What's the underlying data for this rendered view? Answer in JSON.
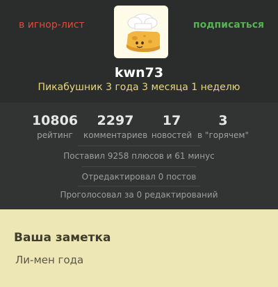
{
  "header": {
    "ignore_label": "в игнор-лист",
    "subscribe_label": "подписаться"
  },
  "profile": {
    "username": "kwn73",
    "tenure": "Пикабушник 3 года 3 месяца 1 неделю"
  },
  "stats": [
    {
      "value": "10806",
      "label": "рейтинг"
    },
    {
      "value": "2297",
      "label": "комментариев"
    },
    {
      "value": "17",
      "label": "новостей"
    },
    {
      "value": "3",
      "label": "в \"горячем\""
    }
  ],
  "activity": {
    "votes": "Поставил 9258 плюсов и 61 минус",
    "edited": "Отредактировал 0 постов",
    "voted_edits": "Проголосовал за 0 редактирований"
  },
  "note": {
    "title": "Ваша заметка",
    "text": "Ли-мен года"
  },
  "colors": {
    "ignore": "#e4493a",
    "subscribe": "#58b154",
    "tenure": "#e8d87a",
    "background_dark": "#2a2d2c",
    "note_bg": "#ede7b6"
  }
}
